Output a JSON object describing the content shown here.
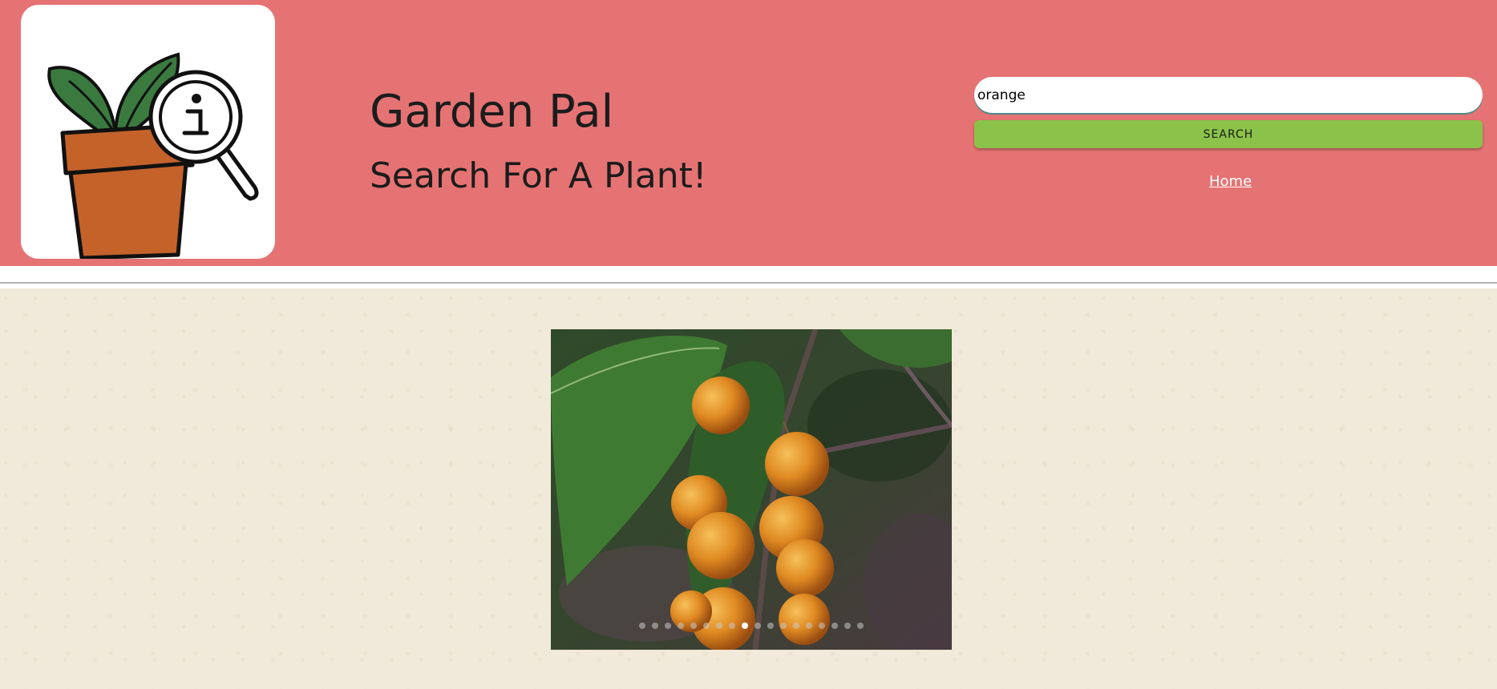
{
  "header": {
    "title": "Garden Pal",
    "subtitle": "Search For A Plant!",
    "background_color": "#e57373"
  },
  "logo": {
    "icon": "plant-info-logo-icon"
  },
  "search": {
    "value": "orange",
    "button_label": "SEARCH",
    "button_color": "#8bc34a"
  },
  "nav": {
    "home_label": "Home"
  },
  "carousel": {
    "image_icon": "orange-berries-photo",
    "slide_count": 18,
    "active_index": 8
  }
}
